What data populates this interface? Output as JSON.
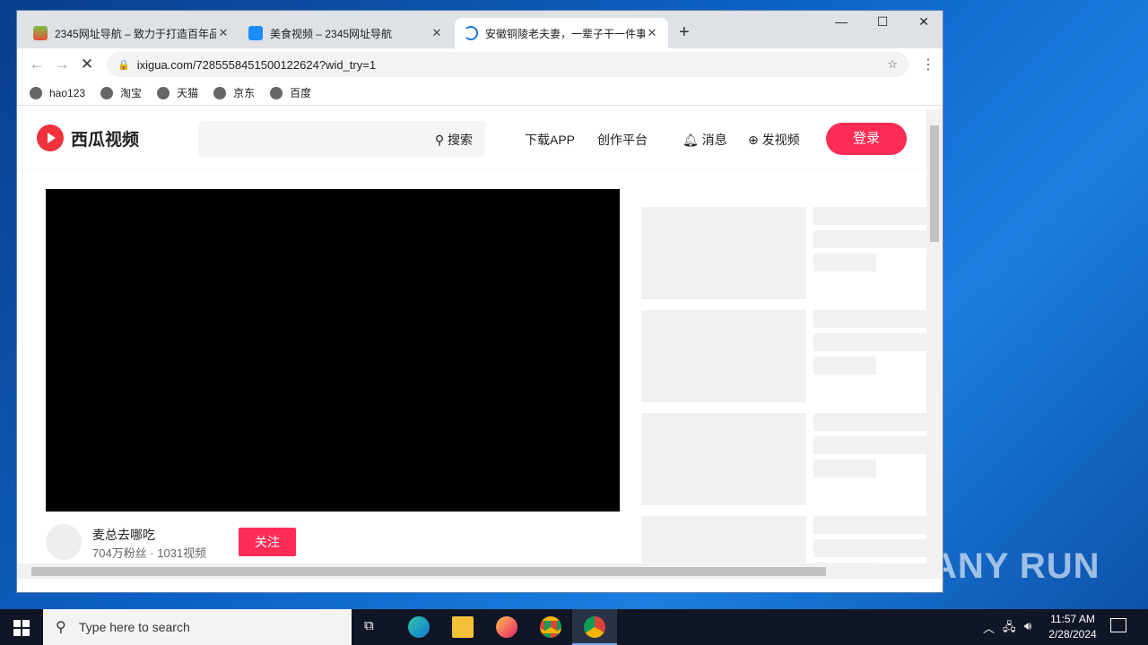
{
  "browser": {
    "tabs": [
      {
        "title": "2345网址导航 – 致力于打造百年品",
        "icon": "2345-icon"
      },
      {
        "title": "美食视频 – 2345网址导航",
        "icon": "video-icon"
      },
      {
        "title": "安徽铜陵老夫妻，一辈子干一件事",
        "icon": "loading-spinner-icon"
      }
    ],
    "url": "ixigua.com/7285558451500122624?wid_try=1",
    "bookmarks": [
      "hao123",
      "淘宝",
      "天猫",
      "京东",
      "百度"
    ]
  },
  "site": {
    "logo": "西瓜视频",
    "search_button": "搜索",
    "nav": [
      "下载APP",
      "创作平台",
      "消息",
      "发视频"
    ],
    "login": "登录",
    "author": {
      "name": "麦总去哪吃",
      "stats": "704万粉丝 · 1031视频",
      "follow": "关注"
    },
    "accent": "#fe2c55"
  },
  "taskbar": {
    "search_placeholder": "Type here to search",
    "time": "11:57 AM",
    "date": "2/28/2024"
  },
  "watermark": "ANY RUN"
}
